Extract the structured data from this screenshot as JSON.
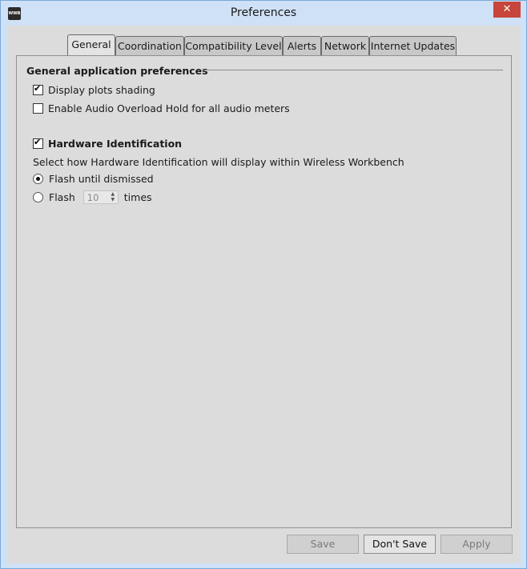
{
  "window": {
    "title": "Preferences",
    "icon_text": "WWB",
    "close_symbol": "✕"
  },
  "tabs": [
    {
      "label": "General",
      "active": true
    },
    {
      "label": "Coordination"
    },
    {
      "label": "Compatibility Level"
    },
    {
      "label": "Alerts"
    },
    {
      "label": "Network"
    },
    {
      "label": "Internet Updates"
    }
  ],
  "general": {
    "section_title": "General application preferences",
    "display_plots_shading": {
      "label": "Display plots shading",
      "checked": true
    },
    "audio_overload_hold": {
      "label": "Enable Audio Overload Hold for all audio meters",
      "checked": false
    },
    "hardware_identification": {
      "label": "Hardware Identification",
      "checked": true
    },
    "hw_description": "Select how Hardware Identification will display within Wireless Workbench",
    "flash_until_dismissed": {
      "label": "Flash until dismissed",
      "selected": true
    },
    "flash_times": {
      "label_before": "Flash",
      "value": "10",
      "label_after": "times",
      "selected": false
    }
  },
  "buttons": {
    "save": "Save",
    "dont_save": "Don't Save",
    "apply": "Apply"
  },
  "colors": {
    "titlebar_bg": "#cfe1f6",
    "close_bg": "#c7453b",
    "panel_bg": "#dcdcdc"
  }
}
